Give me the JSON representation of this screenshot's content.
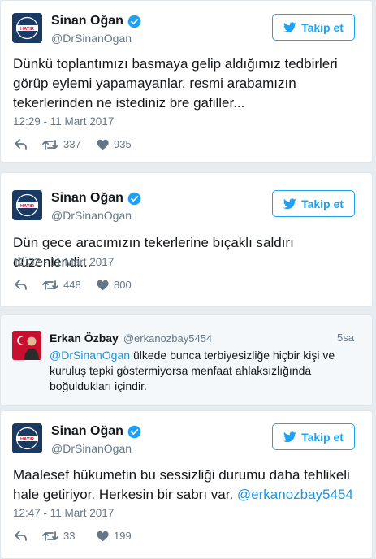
{
  "colors": {
    "accent": "#1da1f2",
    "muted": "#657786",
    "link": "#1b95e0",
    "like": "#657786"
  },
  "follow_label": "Takip et",
  "tweets": [
    {
      "name": "Sinan Oğan",
      "handle": "@DrSinanOgan",
      "text": "Dünkü toplantımızı basmaya gelip aldığımız tedbirleri görüp eylemi yapamayanlar, resmi arabamızın tekerlerinden ne istediniz bre gafiller...",
      "date": "12:29 - 11 Mart 2017",
      "retweets": "337",
      "likes": "935"
    },
    {
      "name": "Sinan Oğan",
      "handle": "@DrSinanOgan",
      "text": "Dün gece aracımızın tekerlerine bıçaklı saldırı düzenlendi...",
      "date": "12:32 - 11 Mart 2017",
      "retweets": "448",
      "likes": "800"
    },
    {
      "name": "Sinan Oğan",
      "handle": "@DrSinanOgan",
      "text": "Maalesef hükumetin bu sessizliği durumu daha tehlikeli hale getiriyor. Herkesin bir sabrı var.",
      "mention": "@erkanozbay5454",
      "date": "12:47 - 11 Mart 2017",
      "retweets": "33",
      "likes": "199"
    }
  ],
  "reply": {
    "name": "Erkan Özbay",
    "handle": "@erkanozbay5454",
    "time": "5sa",
    "mention": "@DrSinanOgan",
    "text": "ülkede bunca terbiyesizliğe hiçbir kişi ve kuruluş tepki göstermiyorsa menfaat ahlaksızlığında boğuldukları içindir."
  },
  "avatar_badge": "HAYIR"
}
